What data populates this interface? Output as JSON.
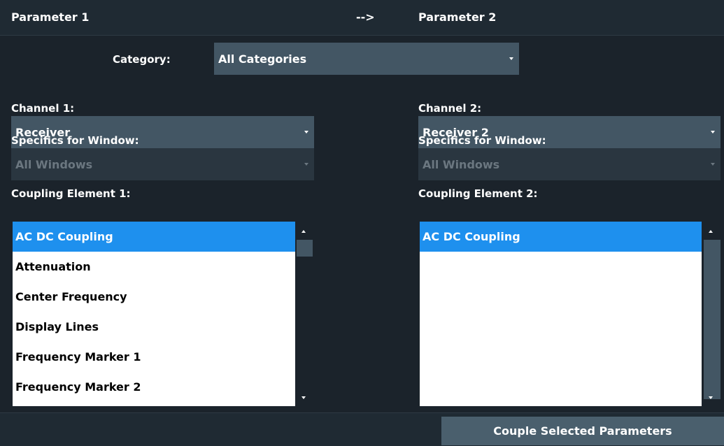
{
  "header": {
    "param1_title": "Parameter 1",
    "arrow": "-->",
    "param2_title": "Parameter 2"
  },
  "category": {
    "label": "Category:",
    "value": "All Categories"
  },
  "left": {
    "channel_label": "Channel 1:",
    "channel_value": "Receiver",
    "window_label": "Specifics for Window:",
    "window_value": "All Windows",
    "element_label": "Coupling Element 1:",
    "elements": [
      "AC DC Coupling",
      "Attenuation",
      "Center Frequency",
      "Display Lines",
      "Frequency Marker 1",
      "Frequency Marker 2"
    ],
    "selected_index": 0
  },
  "right": {
    "channel_label": "Channel 2:",
    "channel_value": "Receiver 2",
    "window_label": "Specifics for Window:",
    "window_value": "All Windows",
    "element_label": "Coupling Element 2:",
    "elements": [
      "AC DC Coupling"
    ],
    "selected_index": 0
  },
  "footer": {
    "couple_label": "Couple Selected Parameters"
  },
  "colors": {
    "background": "#1b232b",
    "field": "#435664",
    "selection": "#1e90ee"
  }
}
